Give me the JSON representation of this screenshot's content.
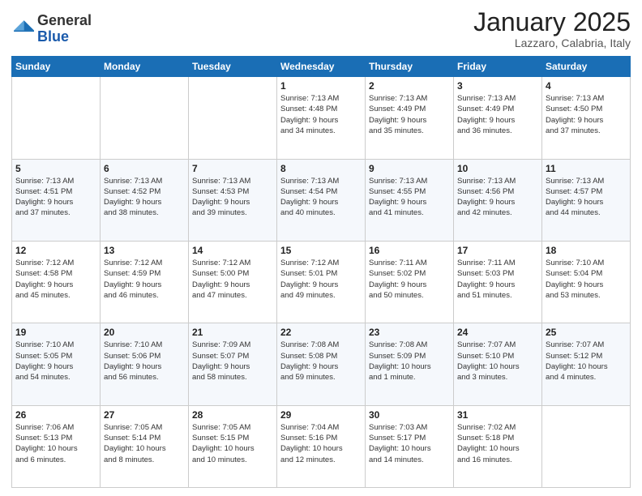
{
  "logo": {
    "general": "General",
    "blue": "Blue"
  },
  "header": {
    "month": "January 2025",
    "location": "Lazzaro, Calabria, Italy"
  },
  "weekdays": [
    "Sunday",
    "Monday",
    "Tuesday",
    "Wednesday",
    "Thursday",
    "Friday",
    "Saturday"
  ],
  "weeks": [
    [
      {
        "day": "",
        "info": ""
      },
      {
        "day": "",
        "info": ""
      },
      {
        "day": "",
        "info": ""
      },
      {
        "day": "1",
        "info": "Sunrise: 7:13 AM\nSunset: 4:48 PM\nDaylight: 9 hours\nand 34 minutes."
      },
      {
        "day": "2",
        "info": "Sunrise: 7:13 AM\nSunset: 4:49 PM\nDaylight: 9 hours\nand 35 minutes."
      },
      {
        "day": "3",
        "info": "Sunrise: 7:13 AM\nSunset: 4:49 PM\nDaylight: 9 hours\nand 36 minutes."
      },
      {
        "day": "4",
        "info": "Sunrise: 7:13 AM\nSunset: 4:50 PM\nDaylight: 9 hours\nand 37 minutes."
      }
    ],
    [
      {
        "day": "5",
        "info": "Sunrise: 7:13 AM\nSunset: 4:51 PM\nDaylight: 9 hours\nand 37 minutes."
      },
      {
        "day": "6",
        "info": "Sunrise: 7:13 AM\nSunset: 4:52 PM\nDaylight: 9 hours\nand 38 minutes."
      },
      {
        "day": "7",
        "info": "Sunrise: 7:13 AM\nSunset: 4:53 PM\nDaylight: 9 hours\nand 39 minutes."
      },
      {
        "day": "8",
        "info": "Sunrise: 7:13 AM\nSunset: 4:54 PM\nDaylight: 9 hours\nand 40 minutes."
      },
      {
        "day": "9",
        "info": "Sunrise: 7:13 AM\nSunset: 4:55 PM\nDaylight: 9 hours\nand 41 minutes."
      },
      {
        "day": "10",
        "info": "Sunrise: 7:13 AM\nSunset: 4:56 PM\nDaylight: 9 hours\nand 42 minutes."
      },
      {
        "day": "11",
        "info": "Sunrise: 7:13 AM\nSunset: 4:57 PM\nDaylight: 9 hours\nand 44 minutes."
      }
    ],
    [
      {
        "day": "12",
        "info": "Sunrise: 7:12 AM\nSunset: 4:58 PM\nDaylight: 9 hours\nand 45 minutes."
      },
      {
        "day": "13",
        "info": "Sunrise: 7:12 AM\nSunset: 4:59 PM\nDaylight: 9 hours\nand 46 minutes."
      },
      {
        "day": "14",
        "info": "Sunrise: 7:12 AM\nSunset: 5:00 PM\nDaylight: 9 hours\nand 47 minutes."
      },
      {
        "day": "15",
        "info": "Sunrise: 7:12 AM\nSunset: 5:01 PM\nDaylight: 9 hours\nand 49 minutes."
      },
      {
        "day": "16",
        "info": "Sunrise: 7:11 AM\nSunset: 5:02 PM\nDaylight: 9 hours\nand 50 minutes."
      },
      {
        "day": "17",
        "info": "Sunrise: 7:11 AM\nSunset: 5:03 PM\nDaylight: 9 hours\nand 51 minutes."
      },
      {
        "day": "18",
        "info": "Sunrise: 7:10 AM\nSunset: 5:04 PM\nDaylight: 9 hours\nand 53 minutes."
      }
    ],
    [
      {
        "day": "19",
        "info": "Sunrise: 7:10 AM\nSunset: 5:05 PM\nDaylight: 9 hours\nand 54 minutes."
      },
      {
        "day": "20",
        "info": "Sunrise: 7:10 AM\nSunset: 5:06 PM\nDaylight: 9 hours\nand 56 minutes."
      },
      {
        "day": "21",
        "info": "Sunrise: 7:09 AM\nSunset: 5:07 PM\nDaylight: 9 hours\nand 58 minutes."
      },
      {
        "day": "22",
        "info": "Sunrise: 7:08 AM\nSunset: 5:08 PM\nDaylight: 9 hours\nand 59 minutes."
      },
      {
        "day": "23",
        "info": "Sunrise: 7:08 AM\nSunset: 5:09 PM\nDaylight: 10 hours\nand 1 minute."
      },
      {
        "day": "24",
        "info": "Sunrise: 7:07 AM\nSunset: 5:10 PM\nDaylight: 10 hours\nand 3 minutes."
      },
      {
        "day": "25",
        "info": "Sunrise: 7:07 AM\nSunset: 5:12 PM\nDaylight: 10 hours\nand 4 minutes."
      }
    ],
    [
      {
        "day": "26",
        "info": "Sunrise: 7:06 AM\nSunset: 5:13 PM\nDaylight: 10 hours\nand 6 minutes."
      },
      {
        "day": "27",
        "info": "Sunrise: 7:05 AM\nSunset: 5:14 PM\nDaylight: 10 hours\nand 8 minutes."
      },
      {
        "day": "28",
        "info": "Sunrise: 7:05 AM\nSunset: 5:15 PM\nDaylight: 10 hours\nand 10 minutes."
      },
      {
        "day": "29",
        "info": "Sunrise: 7:04 AM\nSunset: 5:16 PM\nDaylight: 10 hours\nand 12 minutes."
      },
      {
        "day": "30",
        "info": "Sunrise: 7:03 AM\nSunset: 5:17 PM\nDaylight: 10 hours\nand 14 minutes."
      },
      {
        "day": "31",
        "info": "Sunrise: 7:02 AM\nSunset: 5:18 PM\nDaylight: 10 hours\nand 16 minutes."
      },
      {
        "day": "",
        "info": ""
      }
    ]
  ]
}
